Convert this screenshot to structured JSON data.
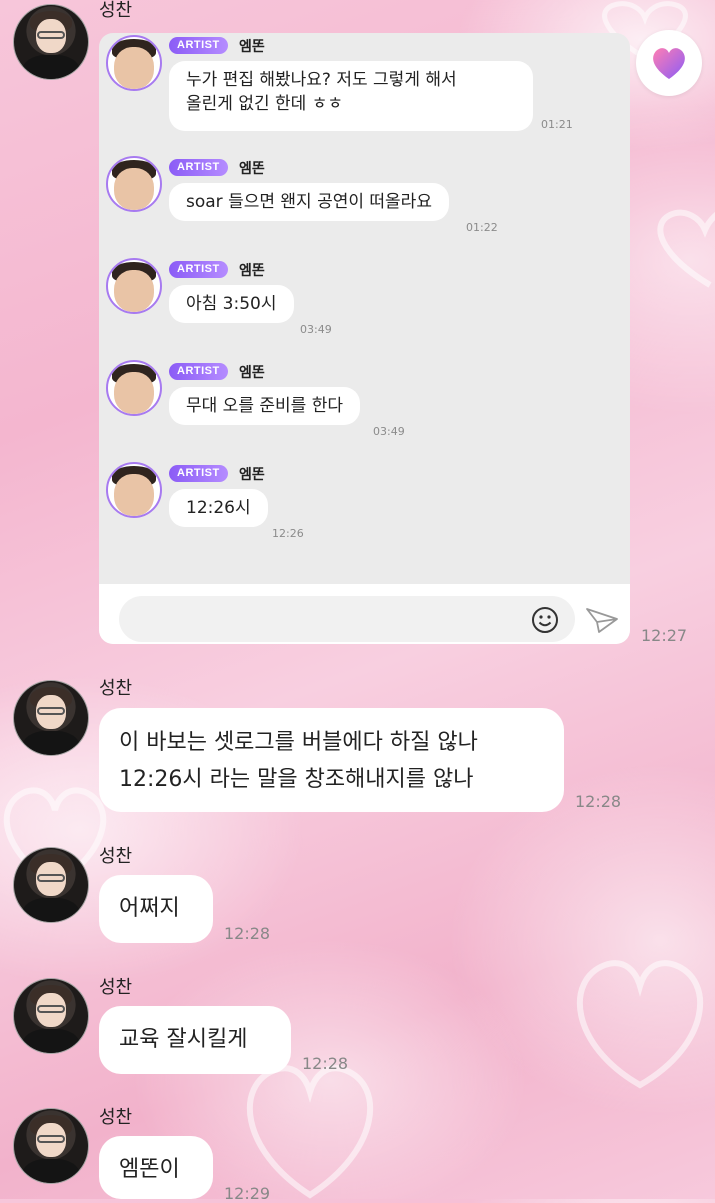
{
  "chat": {
    "sender_name": "성찬",
    "artist_badge": "ARTIST",
    "artist_name": "엠똔",
    "artist_messages": [
      {
        "lines": [
          "누가 편집 해봤나요? 저도 그렇게 해서",
          "올린게 없긴 한데 ㅎㅎ"
        ],
        "time": "01:21"
      },
      {
        "lines": [
          "soar 들으면 왠지 공연이 떠올라요"
        ],
        "time": "01:22"
      },
      {
        "lines": [
          "아침 3:50시"
        ],
        "time": "03:49"
      },
      {
        "lines": [
          "무대 오를 준비를 한다"
        ],
        "time": "03:49"
      },
      {
        "lines": [
          "12:26시"
        ],
        "time": "12:26"
      }
    ],
    "card_time": "12:27",
    "messages": [
      {
        "lines": [
          "이 바보는 셋로그를 버블에다 하질 않나",
          "12:26시 라는 말을 창조해내지를 않나"
        ],
        "time": "12:28"
      },
      {
        "lines": [
          "어쩌지"
        ],
        "time": "12:28"
      },
      {
        "lines": [
          "교육 잘시킬게"
        ],
        "time": "12:28"
      },
      {
        "lines": [
          "엠똔이"
        ],
        "time": "12:29"
      }
    ]
  },
  "icons": {
    "heart": "heart-icon",
    "emoji": "smiley-icon",
    "send": "send-icon"
  },
  "colors": {
    "accent": "#8b5cf6",
    "background": "#f6c2d8"
  }
}
